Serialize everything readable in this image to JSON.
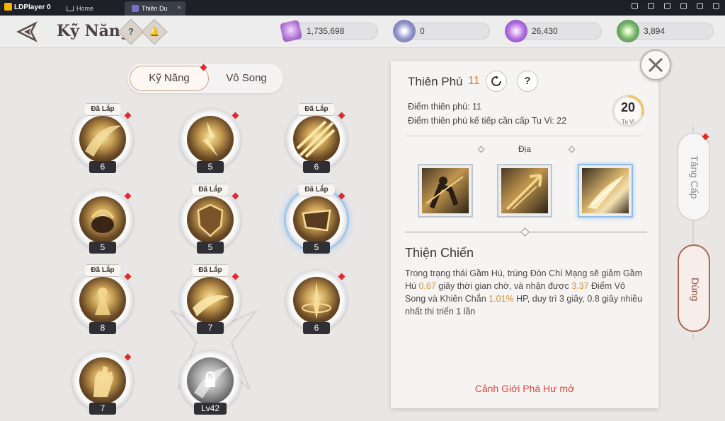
{
  "emulator": {
    "brand": "LDPlayer 0",
    "tabs": [
      {
        "label": "Home"
      },
      {
        "label": "Thiên Du",
        "close": "×"
      }
    ]
  },
  "header": {
    "title": "Kỹ Năng",
    "help_label": "?",
    "currencies": [
      {
        "icon": "purple-crystal-icon",
        "value": "1,735,698"
      },
      {
        "icon": "star-compass-icon",
        "value": "0"
      },
      {
        "icon": "purple-orb-icon",
        "value": "26,430"
      },
      {
        "icon": "green-jade-icon",
        "value": "3,894"
      }
    ]
  },
  "tabs": {
    "skill": "Kỹ Năng",
    "vo_song": "Vô Song"
  },
  "skills": [
    {
      "level": "6",
      "badge": "Đã Lắp",
      "dot": true
    },
    {
      "level": "5",
      "badge": "",
      "dot": true
    },
    {
      "level": "6",
      "badge": "Đã Lắp",
      "dot": true
    },
    {
      "level": "5",
      "badge": "",
      "dot": true
    },
    {
      "level": "5",
      "badge": "Đã Lắp",
      "dot": true
    },
    {
      "level": "5",
      "badge": "Đã Lắp",
      "dot": true,
      "selected": true
    },
    {
      "level": "8",
      "badge": "Đã Lắp",
      "dot": true
    },
    {
      "level": "7",
      "badge": "Đã Lắp",
      "dot": true
    },
    {
      "level": "6",
      "badge": "",
      "dot": true
    },
    {
      "level": "7",
      "badge": "",
      "dot": true
    },
    {
      "level": "Lv42",
      "badge": "",
      "dot": false,
      "locked": true
    }
  ],
  "detail": {
    "title": "Thiên Phú",
    "count": "11",
    "info_label": "?",
    "points_line": "Điểm thiên phú: 11",
    "next_line": "Điểm thiên phú kế tiếp cần cấp Tu Vi: 22",
    "tuvi_value": "20",
    "tuvi_label": "Tu Vi",
    "tuvi_progress": 0.3,
    "tier_label": "Địa",
    "talent_name": "Thiện Chiến",
    "desc_1": "Trong trạng thái Gầm Hú, trúng Đòn Chí Mạng sẽ giảm Gầm Hú ",
    "desc_v1": "0.67",
    "desc_2": " giây thời gian chờ, và nhận được ",
    "desc_v2": "3.37",
    "desc_3": " Điểm Vô Song và Khiên Chắn ",
    "desc_v3": "1.01%",
    "desc_4": " HP, duy trì 3 giây, 0.8 giây nhiều nhất thi triển 1 lần",
    "realm_text": "Cảnh Giới Phá Hư mở"
  },
  "side": {
    "upgrade": "Tăng Cấp",
    "use": "Dùng"
  },
  "colors": {
    "accent_orange": "#e07a2e",
    "highlight": "#d6922a",
    "red_text": "#d8463b",
    "red_dot": "#e3282c"
  }
}
